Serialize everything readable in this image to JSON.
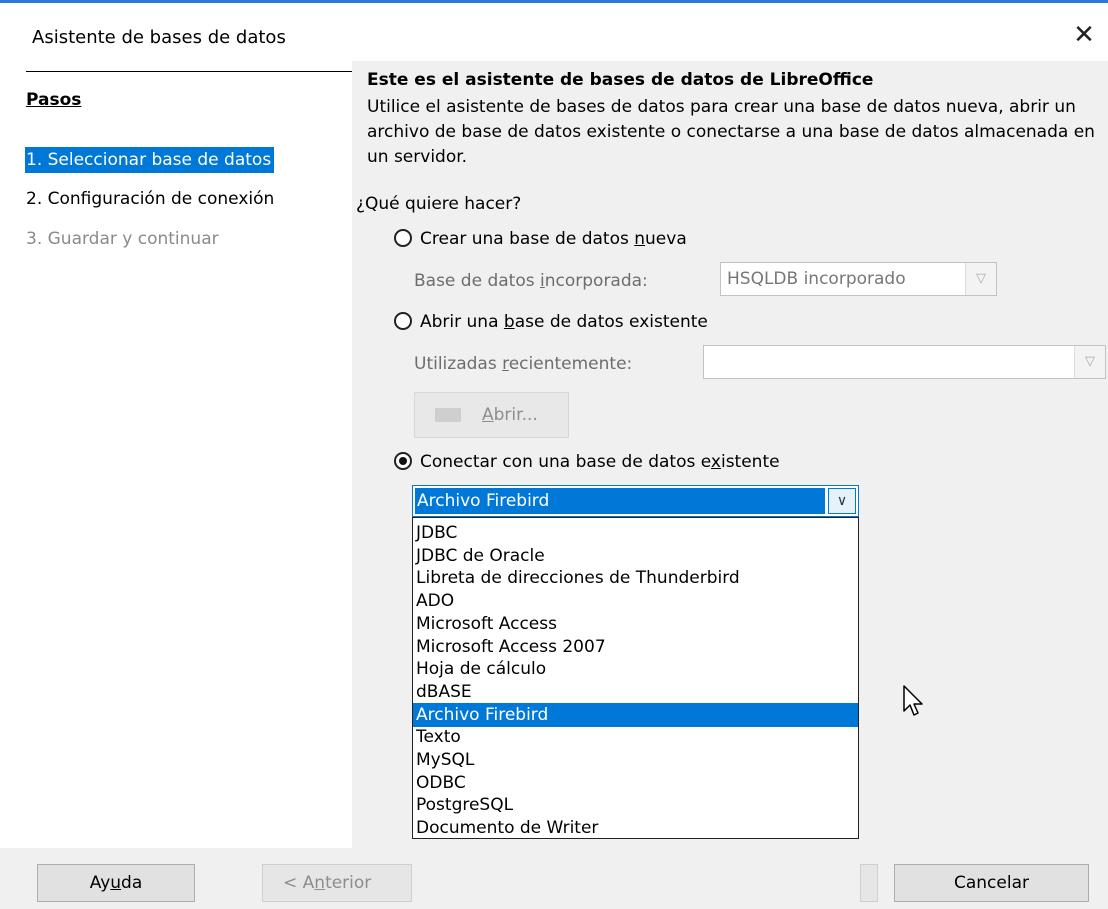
{
  "window": {
    "title": "Asistente de bases de datos",
    "close_glyph": "✕"
  },
  "steps": {
    "heading": "Pasos",
    "items": [
      {
        "label": "1. Seleccionar base de datos",
        "state": "selected"
      },
      {
        "label": "2. Configuración de conexión",
        "state": "enabled"
      },
      {
        "label": "3. Guardar y continuar",
        "state": "disabled"
      }
    ]
  },
  "content": {
    "title": "Este es el asistente de bases de datos de LibreOffice",
    "intro": "Utilice el asistente de bases de datos para crear una base de datos nueva, abrir un archivo de base de datos existente o conectarse a una base de datos almacenada en un servidor.",
    "question": "¿Qué quiere hacer?",
    "option_new": {
      "pre": "Crear una base de datos ",
      "key": "n",
      "post": "ueva",
      "selected": false
    },
    "embedded": {
      "pre": "Base de datos ",
      "key": "i",
      "post": "ncorporada:",
      "value": "HSQLDB incorporado"
    },
    "option_open": {
      "pre": "Abrir una ",
      "key": "b",
      "post": "ase de datos existente",
      "selected": false
    },
    "recent": {
      "pre": "Utilizadas ",
      "key": "r",
      "post": "ecientemente:",
      "value": ""
    },
    "open_button": {
      "key": "A",
      "post": "brir..."
    },
    "option_connect": {
      "pre": "Conectar con una base de datos e",
      "key": "x",
      "post": "istente",
      "selected": true
    },
    "connection": {
      "selected": "Archivo Firebird",
      "options": [
        "JDBC",
        "JDBC de Oracle",
        "Libreta de direcciones de Thunderbird",
        "ADO",
        "Microsoft Access",
        "Microsoft Access 2007",
        "Hoja de cálculo",
        "dBASE",
        "Archivo Firebird",
        "Texto",
        "MySQL",
        "ODBC",
        "PostgreSQL",
        "Documento de Writer"
      ]
    }
  },
  "footer": {
    "help": {
      "pre": "Ay",
      "key": "u",
      "post": "da"
    },
    "back": {
      "pre": "< A",
      "key": "n",
      "post": "terior"
    },
    "cancel": "Cancelar"
  },
  "colors": {
    "accent": "#0078d7",
    "dialog_bg": "#f0f0f0",
    "disabled_text": "#8a8a8a"
  },
  "icons": {
    "close": "close-icon",
    "radio": "radio-icon",
    "dropdown_arrow": "chevron-down-icon",
    "open_folder": "folder-open-icon",
    "cursor": "mouse-pointer-icon"
  }
}
